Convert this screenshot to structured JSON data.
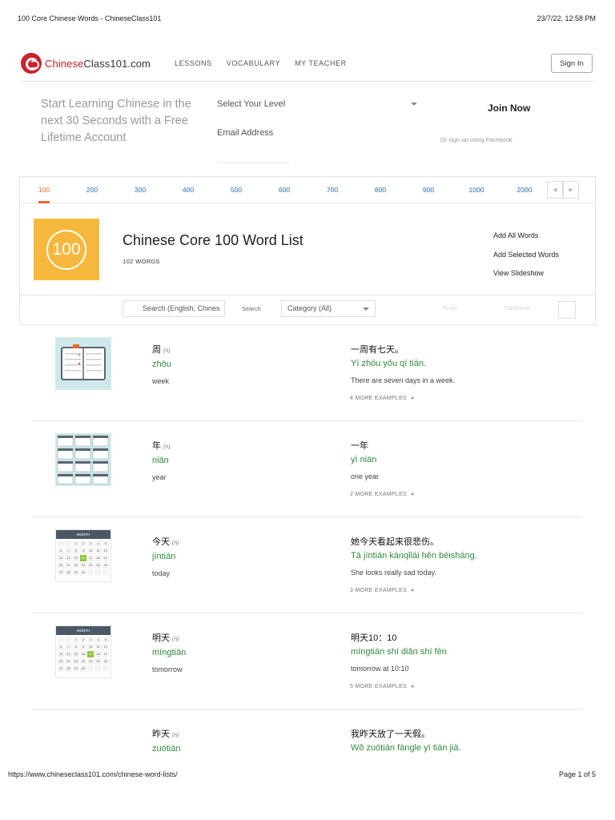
{
  "print": {
    "title": "100 Core Chinese Words - ChineseClass101",
    "datetime": "23/7/22, 12:58 PM",
    "url": "https://www.chineseclass101.com/chinese-word-lists/",
    "page": "Page 1 of 5"
  },
  "nav": {
    "logo_chinese": "Chinese",
    "logo_rest": "Class101.com",
    "links": [
      "LESSONS",
      "VOCABULARY",
      "MY TEACHER"
    ],
    "sign_in": "Sign In"
  },
  "signup": {
    "promo": "Start Learning Chinese in the next 30 Seconds with a Free Lifetime Account",
    "level_placeholder": "Select Your Level",
    "email_placeholder": "Email Address",
    "join": "Join Now",
    "facebook": "Or sign up using Facebook"
  },
  "pager": {
    "items": [
      "100",
      "200",
      "300",
      "400",
      "500",
      "600",
      "700",
      "800",
      "900",
      "1000",
      "2000"
    ],
    "active_index": 0,
    "prev": "◀",
    "next": "▶"
  },
  "list": {
    "badge": "100",
    "title": "Chinese Core 100 Word List",
    "count": "102 WORDS",
    "actions": [
      "Add All Words",
      "Add Selected Words",
      "View Slideshow"
    ]
  },
  "filter": {
    "search_placeholder": "Search (English, Chines",
    "search_button": "Search",
    "category": "Category (All)",
    "pinyin_toggle": "Pinyin",
    "traditional_toggle": "Traditional"
  },
  "words": [
    {
      "hanzi": "周",
      "pos": "(n)",
      "pinyin": "zhōu",
      "english": "week",
      "example_zh": "一周有七天。",
      "example_py": "Yī zhōu yǒu qī tiān.",
      "example_en": "There are seven days in a week.",
      "more": "4 MORE EXAMPLES",
      "image": "planner-icon"
    },
    {
      "hanzi": "年",
      "pos": "(n)",
      "pinyin": "nián",
      "english": "year",
      "example_zh": "一年",
      "example_py": "yì nián",
      "example_en": "one year",
      "more": "2 MORE EXAMPLES",
      "image": "year-calendar-icon"
    },
    {
      "hanzi": "今天",
      "pos": "(n)",
      "pinyin": "jīntiān",
      "english": "today",
      "example_zh": "她今天看起来很悲伤。",
      "example_py": "Tā jīntiān kànqǐlái hěn bēishāng.",
      "example_en": "She looks really sad today.",
      "more": "3 MORE EXAMPLES",
      "image": "month-calendar-icon"
    },
    {
      "hanzi": "明天",
      "pos": "(n)",
      "pinyin": "míngtiān",
      "english": "tomorrow",
      "example_zh": "明天10：10",
      "example_py": "míngtiān shí diǎn shí fēn",
      "example_en": "tomorrow at 10:10",
      "more": "5 MORE EXAMPLES",
      "image": "month-calendar-icon"
    },
    {
      "hanzi": "昨天",
      "pos": "(n)",
      "pinyin": "zuótiān",
      "english": "",
      "example_zh": "我昨天放了一天假。",
      "example_py": "Wǒ zuótiān fàngle yì tiān jià.",
      "example_en": "",
      "more": "",
      "image": ""
    }
  ],
  "colors": {
    "accent": "#e8682a",
    "link": "#2a6fbb",
    "pinyin": "#2f8a3a",
    "badge": "#f6b83c",
    "brand": "#c8232c"
  }
}
